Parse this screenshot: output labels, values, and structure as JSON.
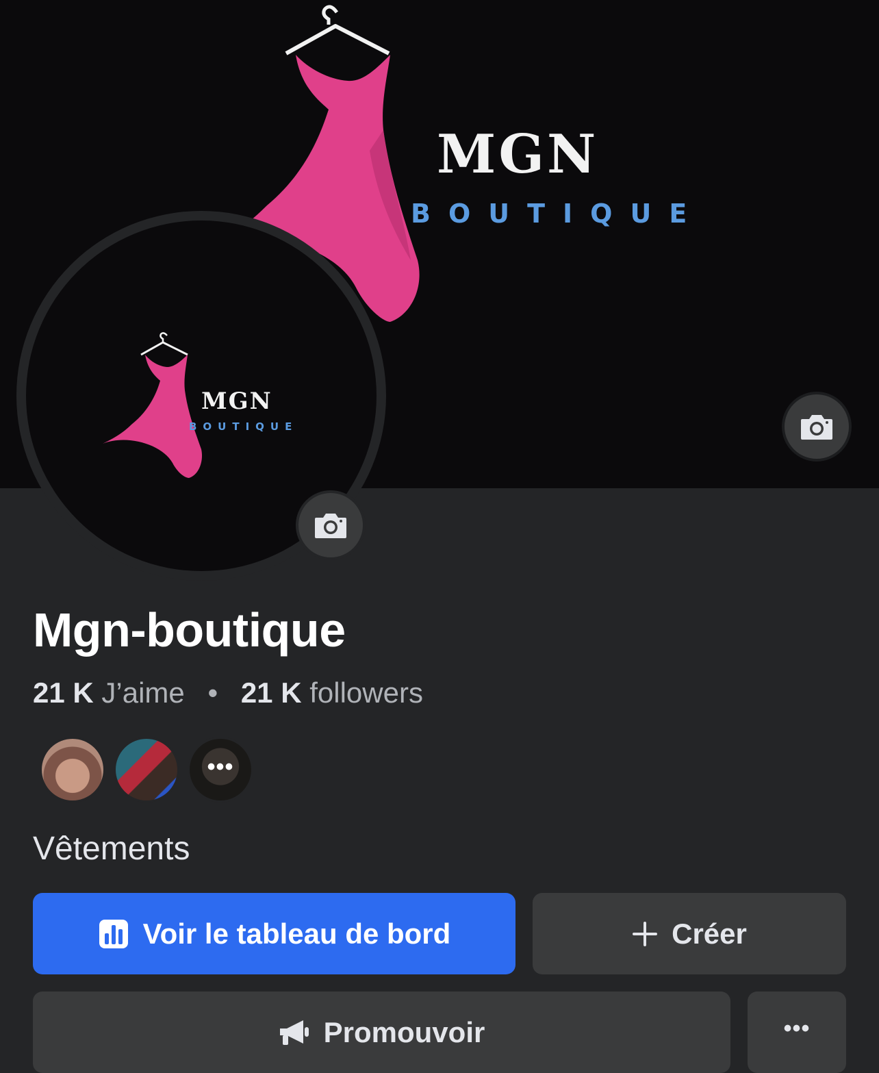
{
  "cover": {
    "logo_title": "MGN",
    "logo_subtitle": "BOUTIQUE",
    "edit_cover_icon": "camera-icon"
  },
  "profile_picture": {
    "logo_title": "MGN",
    "logo_subtitle": "BOUTIQUE",
    "edit_avatar_icon": "camera-icon"
  },
  "page": {
    "name": "Mgn-boutique",
    "likes_count": "21 K",
    "likes_label": "J’aime",
    "separator": "•",
    "followers_count": "21 K",
    "followers_label": "followers",
    "category": "Vêtements"
  },
  "friends": {
    "more_label": "•••"
  },
  "actions": {
    "dashboard_label": "Voir le tableau de bord",
    "create_label": "Créer",
    "promote_label": "Promouvoir",
    "more_label": "•••"
  },
  "colors": {
    "background": "#242527",
    "cover_background": "#0b0a0c",
    "primary_button": "#2d6bf0",
    "secondary_button": "#3a3b3c",
    "logo_pink": "#e0408a",
    "logo_blue": "#5b9be0"
  }
}
